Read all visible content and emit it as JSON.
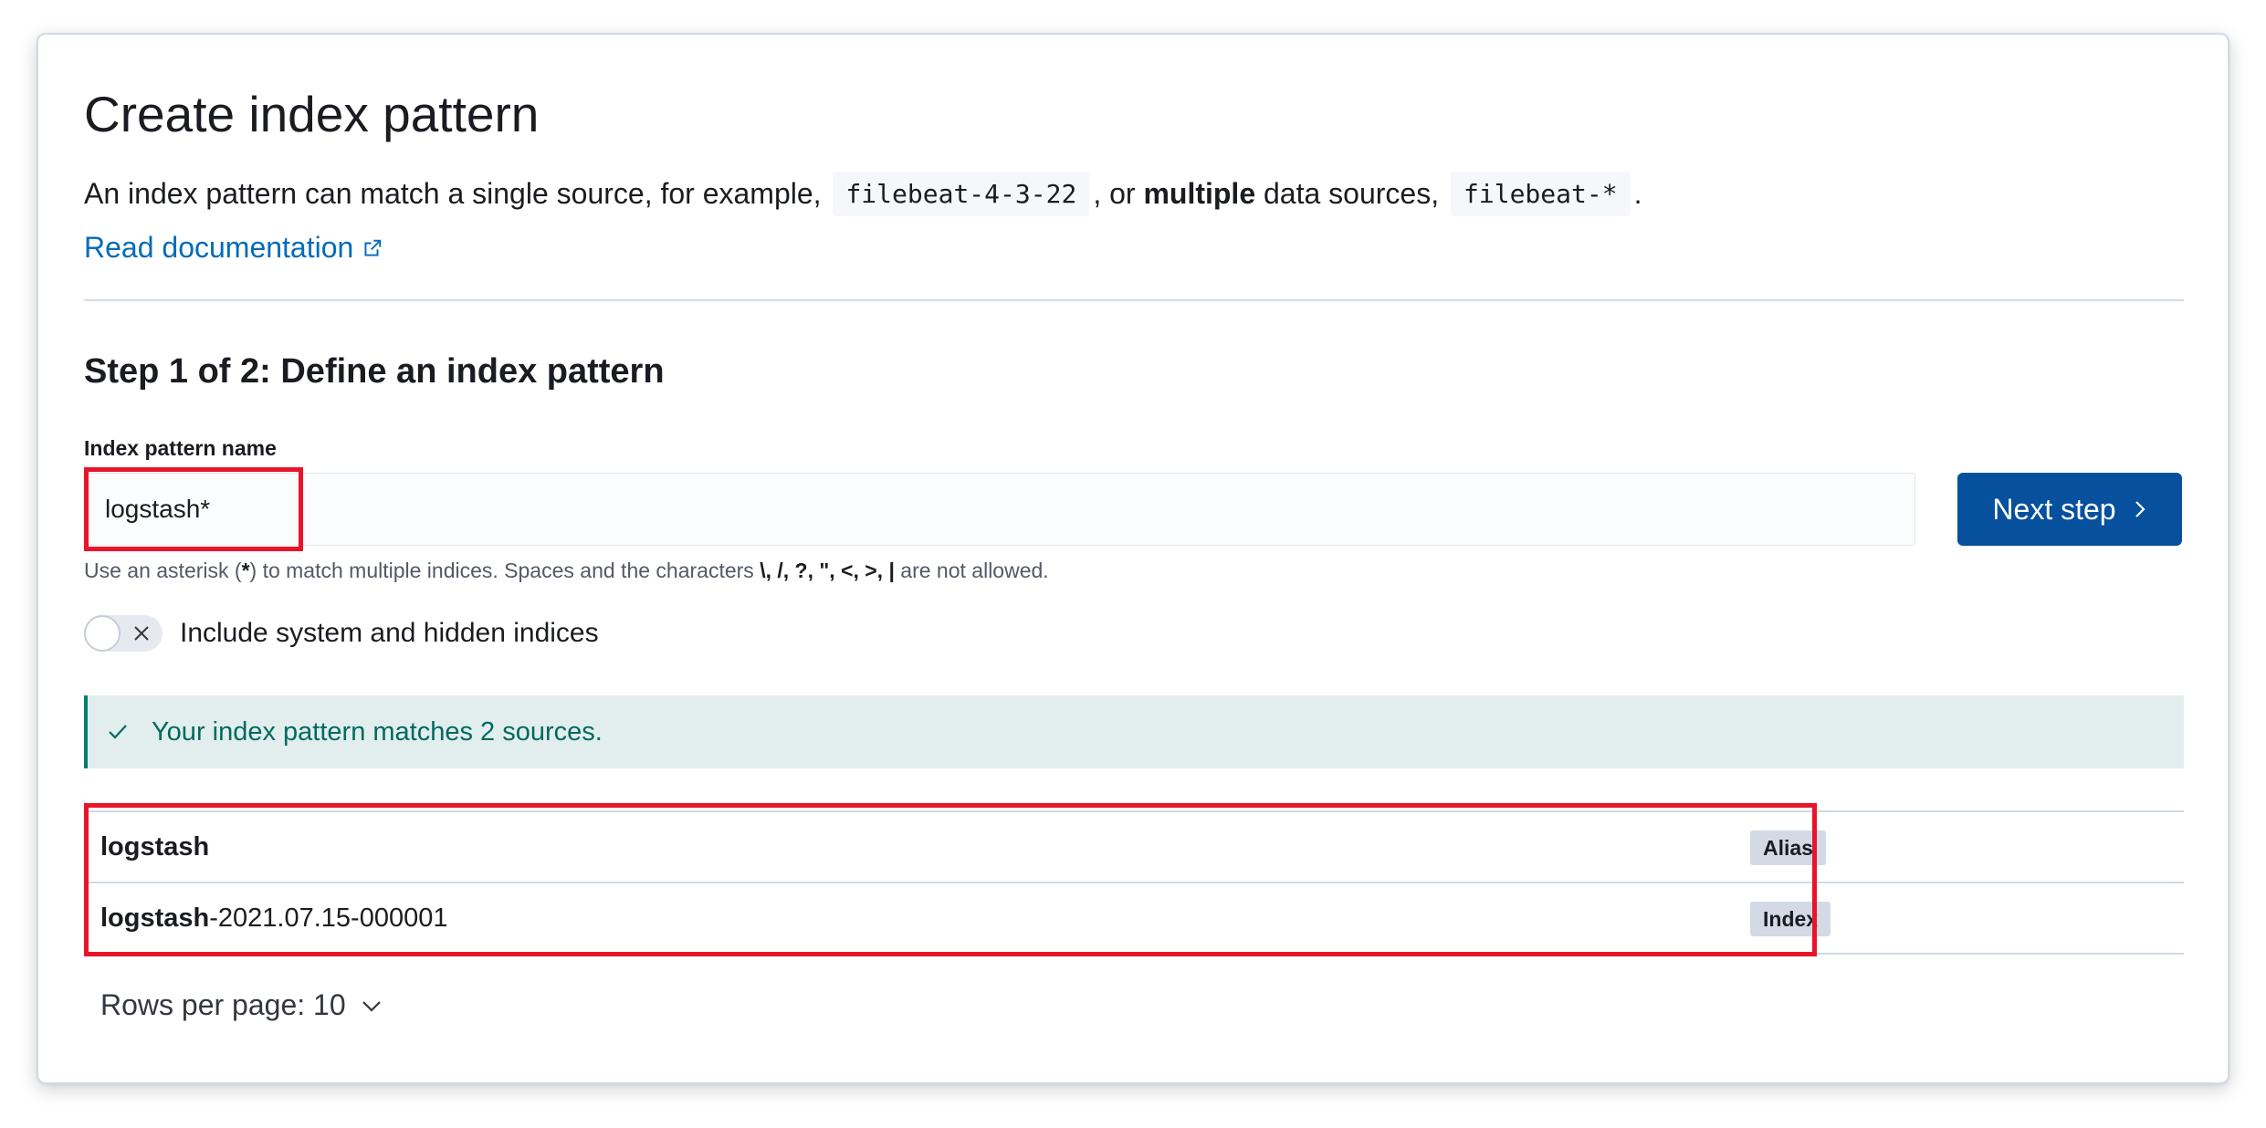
{
  "page": {
    "title": "Create index pattern",
    "description": {
      "prefix": "An index pattern can match a single source, for example,",
      "example_single": "filebeat-4-3-22",
      "middle_before_bold": ", or",
      "bold_word": "multiple",
      "middle_after_bold": "data sources,",
      "example_multiple": "filebeat-*",
      "suffix": "."
    },
    "doc_link": "Read documentation",
    "step_title": "Step 1 of 2: Define an index pattern"
  },
  "form": {
    "field_label": "Index pattern name",
    "input_value": "logstash*",
    "help": {
      "prefix": "Use an asterisk (",
      "asterisk": "*",
      "middle": ") to match multiple indices. Spaces and the characters",
      "chars": "\\, /, ?, \", <, >, |",
      "suffix": "are not allowed."
    },
    "next_button": "Next step",
    "toggle_label": "Include system and hidden indices",
    "toggle_on": false
  },
  "callout": {
    "text": "Your index pattern matches 2 sources."
  },
  "sources": [
    {
      "name_bold": "logstash",
      "name_rest": "",
      "type": "Alias"
    },
    {
      "name_bold": "logstash",
      "name_rest": "-2021.07.15-000001",
      "type": "Index"
    }
  ],
  "pagination": {
    "rows_per_page": "Rows per page: 10"
  },
  "colors": {
    "primary_button": "#07509e",
    "link": "#006bb8",
    "success_callout_bg": "#e1eeed",
    "success_text": "#00695f",
    "highlight_box": "#e8152a"
  }
}
